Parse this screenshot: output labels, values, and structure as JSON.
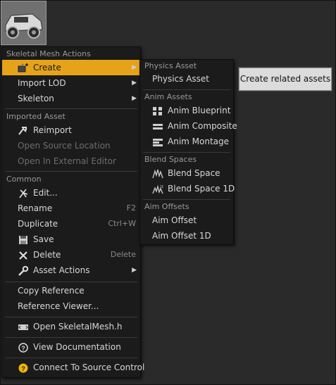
{
  "main_menu": {
    "sections": [
      {
        "title": "Skeletal Mesh Actions",
        "items": [
          {
            "label": "Create",
            "icon": "create-icon",
            "submenu": true,
            "highlight": true
          },
          {
            "label": "Import LOD",
            "submenu": true
          },
          {
            "label": "Skeleton",
            "submenu": true
          }
        ]
      },
      {
        "title": "Imported Asset",
        "items": [
          {
            "label": "Reimport",
            "icon": "reimport-icon"
          },
          {
            "label": "Open Source Location",
            "disabled": true
          },
          {
            "label": "Open In External Editor",
            "disabled": true
          }
        ]
      },
      {
        "title": "Common",
        "items": [
          {
            "label": "Edit...",
            "icon": "edit-icon"
          },
          {
            "label": "Rename",
            "shortcut": "F2"
          },
          {
            "label": "Duplicate",
            "shortcut": "Ctrl+W"
          },
          {
            "label": "Save",
            "icon": "save-icon"
          },
          {
            "label": "Delete",
            "icon": "delete-icon",
            "shortcut": "Delete"
          },
          {
            "label": "Asset Actions",
            "icon": "wrench-icon",
            "submenu": true
          }
        ]
      }
    ],
    "extra": [
      {
        "label": "Copy Reference"
      },
      {
        "label": "Reference Viewer..."
      },
      {
        "label": "Open SkeletalMesh.h",
        "icon": "source-code-icon"
      },
      {
        "label": "View Documentation",
        "icon": "help-icon"
      },
      {
        "label": "Connect To Source Control",
        "icon": "source-control-icon"
      }
    ]
  },
  "sub_menu": {
    "sections": [
      {
        "title": "Physics Asset",
        "items": [
          {
            "label": "Physics Asset"
          }
        ]
      },
      {
        "title": "Anim Assets",
        "items": [
          {
            "label": "Anim Blueprint",
            "icon": "anim-blueprint-icon"
          },
          {
            "label": "Anim Composite",
            "icon": "anim-composite-icon"
          },
          {
            "label": "Anim Montage",
            "icon": "anim-montage-icon"
          }
        ]
      },
      {
        "title": "Blend Spaces",
        "items": [
          {
            "label": "Blend Space",
            "icon": "blend-space-icon"
          },
          {
            "label": "Blend Space 1D",
            "icon": "blend-space-1d-icon"
          }
        ]
      },
      {
        "title": "Aim Offsets",
        "items": [
          {
            "label": "Aim Offset"
          },
          {
            "label": "Aim Offset 1D"
          }
        ]
      }
    ]
  },
  "tooltip": {
    "text": "Create related assets"
  },
  "colors": {
    "highlight": "#e6a31a",
    "menu_bg": "#1b1b1b",
    "canvas_bg": "#2a2a2a"
  }
}
